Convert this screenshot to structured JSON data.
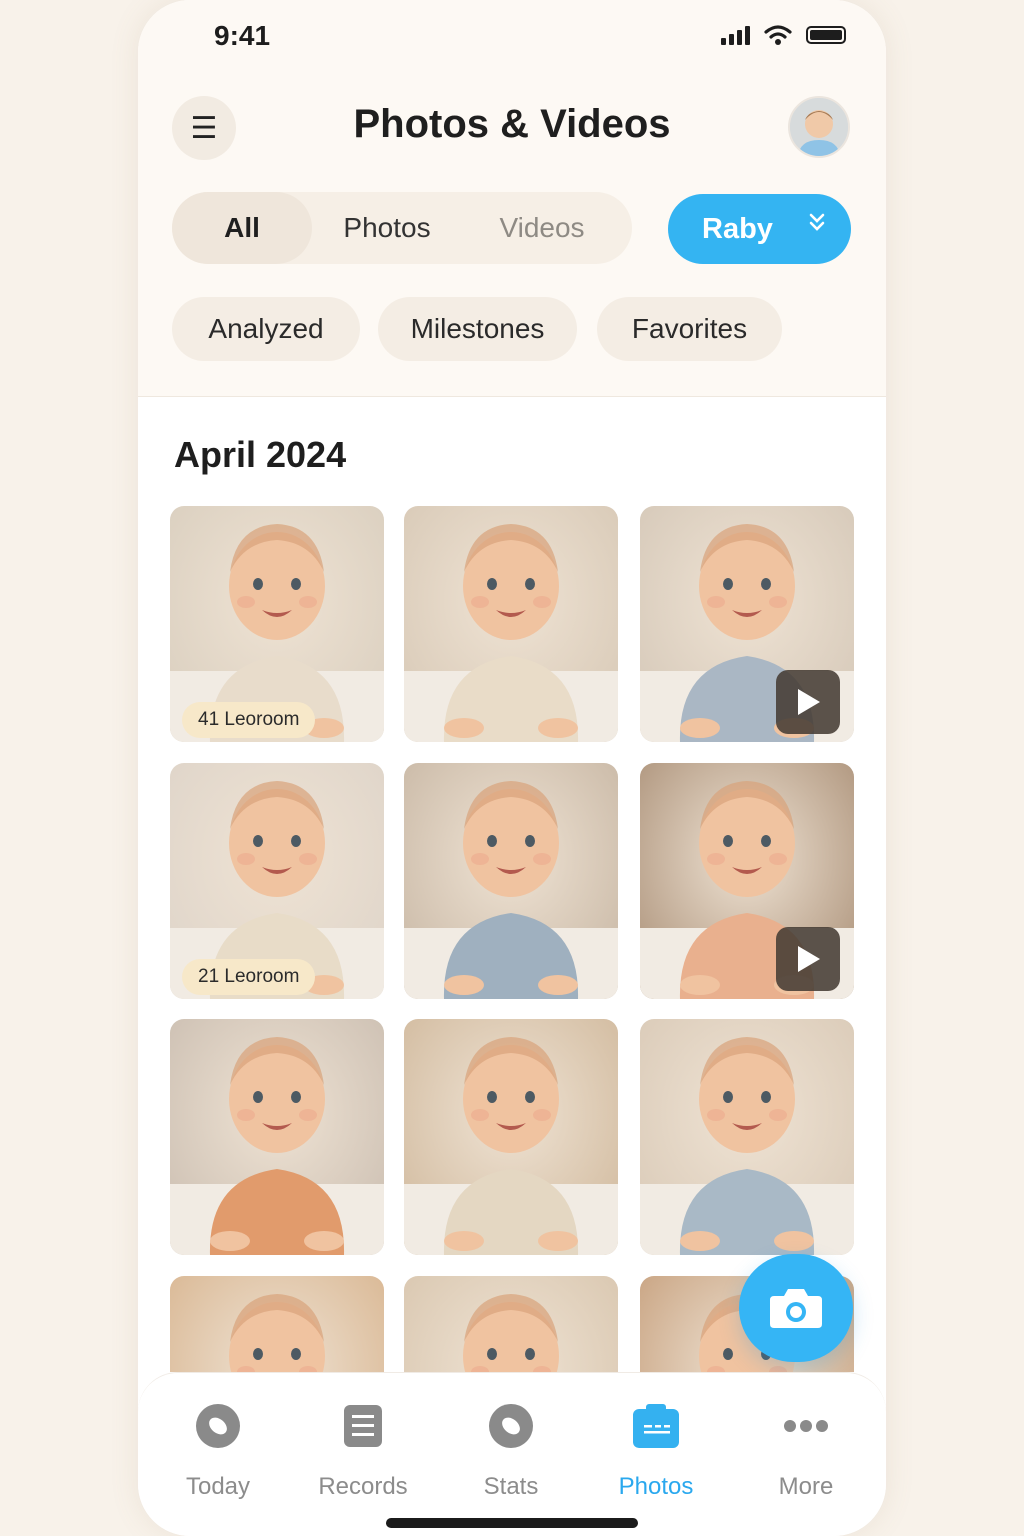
{
  "status": {
    "time": "9:41"
  },
  "header": {
    "title": "Photos & Videos",
    "menu_icon": "menu-icon",
    "avatar": "profile-avatar"
  },
  "filter_tabs": [
    {
      "label": "All",
      "active": true
    },
    {
      "label": "Photos",
      "active": false
    },
    {
      "label": "Videos",
      "active": false
    }
  ],
  "child_selector": {
    "label": "Raby",
    "color": "#34b4f2"
  },
  "chips": [
    "Analyzed",
    "Milestones",
    "Favorites"
  ],
  "section": {
    "month": "April 2024"
  },
  "tiles": [
    {
      "label": "41  Leoroom",
      "video": false,
      "shirt": "#e8dccb",
      "bg": "#d8cdbd"
    },
    {
      "label": "",
      "video": false,
      "shirt": "#e9dcc8",
      "bg": "#d6c7b4"
    },
    {
      "label": "",
      "video": true,
      "shirt": "#aab7c4",
      "bg": "#d3c6b6"
    },
    {
      "label": "21  Leoroom",
      "video": false,
      "shirt": "#e8dcc8",
      "bg": "#ddd3c8"
    },
    {
      "label": "",
      "video": false,
      "shirt": "#9fb0bf",
      "bg": "#c6b5a2"
    },
    {
      "label": "",
      "video": true,
      "shirt": "#e9b08e",
      "bg": "#a88d74"
    },
    {
      "label": "",
      "video": false,
      "shirt": "#e19b6c",
      "bg": "#c9bcaf"
    },
    {
      "label": "",
      "video": false,
      "shirt": "#e4d7c2",
      "bg": "#cfb79a"
    },
    {
      "label": "",
      "video": false,
      "shirt": "#a9b9c6",
      "bg": "#d8c8b5"
    },
    {
      "label": "",
      "video": false,
      "shirt": "#e0d0bb",
      "bg": "#d7b38d"
    },
    {
      "label": "",
      "video": false,
      "shirt": "#e2d3bf",
      "bg": "#d7c4ac"
    },
    {
      "label": "",
      "video": false,
      "shirt": "#dcc6aa",
      "bg": "#c49c78"
    }
  ],
  "fab": {
    "icon": "camera-icon",
    "color": "#35b5f5"
  },
  "tabbar": [
    {
      "label": "Today",
      "icon": "today-icon",
      "active": false
    },
    {
      "label": "Records",
      "icon": "records-icon",
      "active": false
    },
    {
      "label": "Stats",
      "icon": "stats-icon",
      "active": false
    },
    {
      "label": "Photos",
      "icon": "photos-icon",
      "active": true
    },
    {
      "label": "More",
      "icon": "more-icon",
      "active": false
    }
  ],
  "colors": {
    "accent": "#35b5f5",
    "background": "#f8f2ea",
    "chip": "#f4ede4"
  }
}
